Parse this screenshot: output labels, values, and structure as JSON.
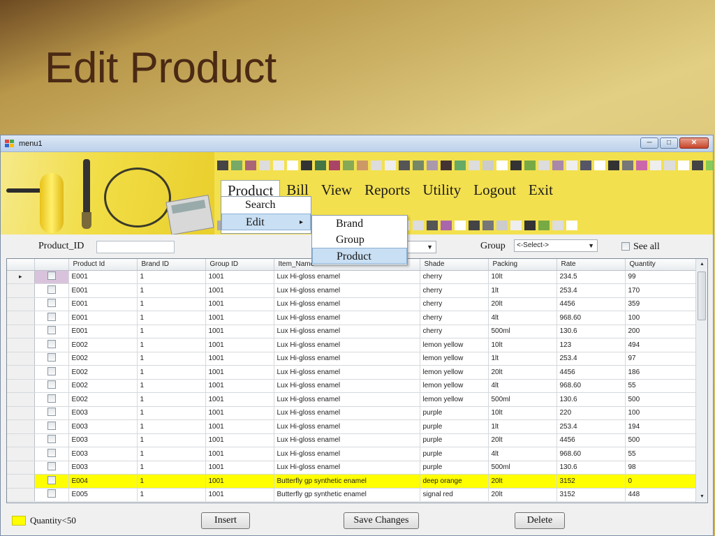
{
  "slide_title": "Edit Product",
  "window": {
    "title": "menu1",
    "minimize": "─",
    "maximize": "□",
    "close": "✕"
  },
  "menubar": [
    "Product",
    "Bill",
    "View",
    "Reports",
    "Utility",
    "Logout",
    "Exit"
  ],
  "product_menu": [
    "Search",
    "Edit"
  ],
  "edit_submenu": [
    "Brand",
    "Group",
    "Product"
  ],
  "submenu_arrow": "▸",
  "filter": {
    "product_id_label": "Product_ID",
    "product_id_value": "",
    "group_label": "Group",
    "group_value": "<-Select->",
    "see_all_label": "See all"
  },
  "columns": [
    "Product Id",
    "Brand ID",
    "Group ID",
    "Item_Name",
    "Shade",
    "Packing",
    "Rate",
    "Quantity"
  ],
  "rows": [
    [
      "E001",
      "1",
      "1001",
      "Lux Hi-gloss enamel",
      "cherry",
      "10lt",
      "234.5",
      "99"
    ],
    [
      "E001",
      "1",
      "1001",
      "Lux Hi-gloss enamel",
      "cherry",
      "1lt",
      "253.4",
      "170"
    ],
    [
      "E001",
      "1",
      "1001",
      "Lux Hi-gloss enamel",
      "cherry",
      "20lt",
      "4456",
      "359"
    ],
    [
      "E001",
      "1",
      "1001",
      "Lux Hi-gloss enamel",
      "cherry",
      "4lt",
      "968.60",
      "100"
    ],
    [
      "E001",
      "1",
      "1001",
      "Lux Hi-gloss enamel",
      "cherry",
      "500ml",
      "130.6",
      "200"
    ],
    [
      "E002",
      "1",
      "1001",
      "Lux Hi-gloss enamel",
      "lemon yellow",
      "10lt",
      "123",
      "494"
    ],
    [
      "E002",
      "1",
      "1001",
      "Lux Hi-gloss enamel",
      "lemon yellow",
      "1lt",
      "253.4",
      "97"
    ],
    [
      "E002",
      "1",
      "1001",
      "Lux Hi-gloss enamel",
      "lemon yellow",
      "20lt",
      "4456",
      "186"
    ],
    [
      "E002",
      "1",
      "1001",
      "Lux Hi-gloss enamel",
      "lemon yellow",
      "4lt",
      "968.60",
      "55"
    ],
    [
      "E002",
      "1",
      "1001",
      "Lux Hi-gloss enamel",
      "lemon yellow",
      "500ml",
      "130.6",
      "500"
    ],
    [
      "E003",
      "1",
      "1001",
      "Lux Hi-gloss enamel",
      "purple",
      "10lt",
      "220",
      "100"
    ],
    [
      "E003",
      "1",
      "1001",
      "Lux Hi-gloss enamel",
      "purple",
      "1lt",
      "253.4",
      "194"
    ],
    [
      "E003",
      "1",
      "1001",
      "Lux Hi-gloss enamel",
      "purple",
      "20lt",
      "4456",
      "500"
    ],
    [
      "E003",
      "1",
      "1001",
      "Lux Hi-gloss enamel",
      "purple",
      "4lt",
      "968.60",
      "55"
    ],
    [
      "E003",
      "1",
      "1001",
      "Lux Hi-gloss enamel",
      "purple",
      "500ml",
      "130.6",
      "98"
    ],
    [
      "E004",
      "1",
      "1001",
      "Butterfly gp synthetic enamel",
      "deep orange",
      "20lt",
      "3152",
      "0"
    ],
    [
      "E005",
      "1",
      "1001",
      "Butterfly gp synthetic enamel",
      "signal red",
      "20lt",
      "3152",
      "448"
    ]
  ],
  "highlighted_row_index": 15,
  "current_row_marker": "▸",
  "legend_label": "Quantity<50",
  "buttons": {
    "insert": "Insert",
    "save": "Save Changes",
    "delete": "Delete"
  },
  "colors": {
    "low_quantity": "#ffff00",
    "banner": "#f3e04e",
    "title": "#4a2a14"
  },
  "swatch_colors_top": [
    "#444",
    "#7a6",
    "#a67",
    "#ddd",
    "#eee",
    "#fff",
    "#333",
    "#474",
    "#a46",
    "#8a5",
    "#c96",
    "#ddd",
    "#eee",
    "#555",
    "#786",
    "#a9a",
    "#433",
    "#6a6",
    "#ddd",
    "#ccc",
    "#fff",
    "#333",
    "#7a4",
    "#ddd",
    "#a8a",
    "#eee",
    "#556",
    "#fff",
    "#333",
    "#777",
    "#c6a",
    "#eee",
    "#ddd",
    "#fff",
    "#444",
    "#8c5",
    "#ddd",
    "#eee",
    "#333"
  ],
  "swatch_colors_bot": [
    "#aaa",
    "#444",
    "#ddd",
    "#fff",
    "#333",
    "#777",
    "#a46",
    "#eee",
    "#ddd",
    "#fff",
    "#333",
    "#8a5",
    "#c96",
    "#eee",
    "#ddd",
    "#555",
    "#a6a",
    "#fff",
    "#444",
    "#777",
    "#ccc",
    "#eee",
    "#333",
    "#7a4",
    "#ddd",
    "#fff"
  ]
}
